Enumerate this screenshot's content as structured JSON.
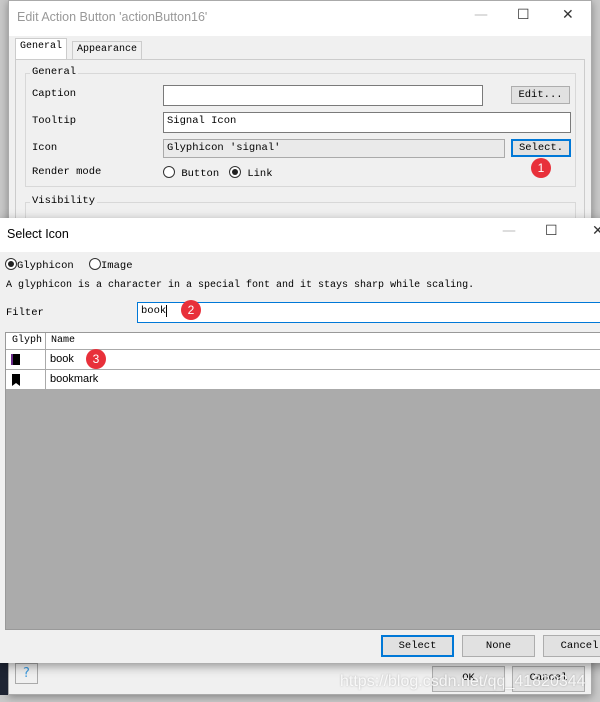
{
  "outer_dialog": {
    "title": "Edit Action Button 'actionButton16'",
    "tabs": [
      {
        "label": "General",
        "active": true
      },
      {
        "label": "Appearance",
        "active": false
      }
    ],
    "general_group": {
      "legend": "General",
      "caption": {
        "label": "Caption",
        "value": "",
        "button": "Edit..."
      },
      "tooltip": {
        "label": "Tooltip",
        "value": "Signal Icon"
      },
      "icon": {
        "label": "Icon",
        "value": "Glyphicon 'signal'",
        "button": "Select."
      },
      "render_mode": {
        "label": "Render mode",
        "options": [
          "Button",
          "Link"
        ],
        "selected": "Link"
      }
    },
    "visibility_group": {
      "legend": "Visibility"
    },
    "ok": "OK",
    "cancel": "Cancel",
    "help": "?"
  },
  "select_icon_dialog": {
    "title": "Select Icon",
    "type_options": [
      "Glyphicon",
      "Image"
    ],
    "type_selected": "Glyphicon",
    "description": "A glyphicon is a character in a special font and it stays sharp while scaling.",
    "filter": {
      "label": "Filter",
      "value": "book"
    },
    "columns": [
      "Glyph",
      "Name"
    ],
    "rows": [
      {
        "glyph": "book-icon",
        "name": "book"
      },
      {
        "glyph": "bookmark-icon",
        "name": "bookmark"
      }
    ],
    "buttons": {
      "select": "Select",
      "none": "None",
      "cancel": "Cancel"
    }
  },
  "badges": [
    "1",
    "2",
    "3"
  ],
  "watermark": "https://blog.csdn.net/qq_41820344"
}
